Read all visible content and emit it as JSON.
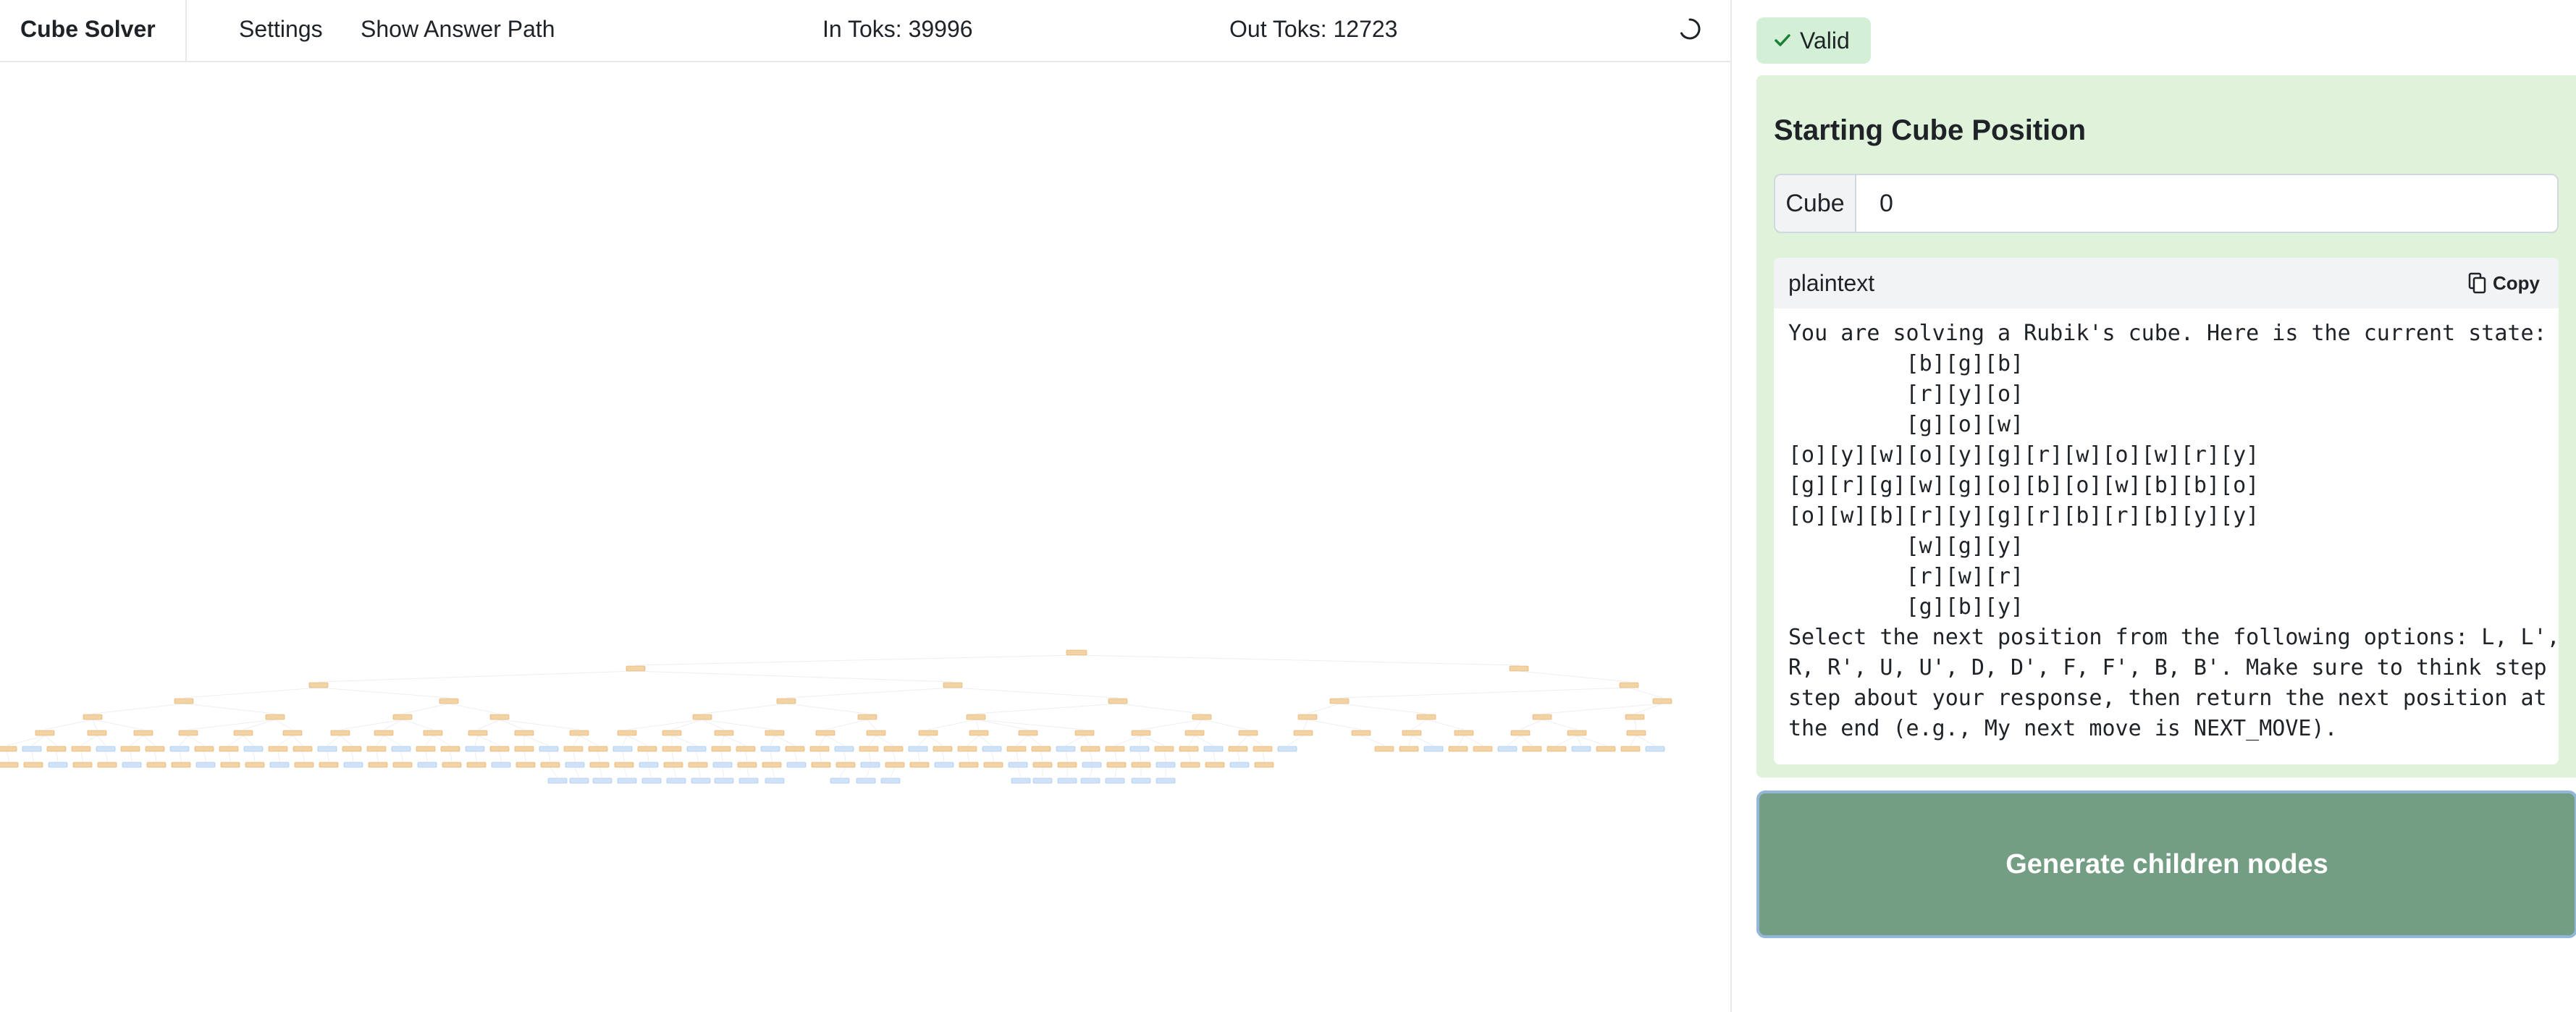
{
  "app": {
    "brand": "Cube Solver",
    "nav": {
      "settings": "Settings",
      "show_answer_path": "Show Answer Path"
    },
    "in_toks": "In Toks: 39996",
    "out_toks": "Out Toks: 12723",
    "loading_icon": "spinner-icon"
  },
  "panel": {
    "status_badge": {
      "label": "Valid",
      "icon": "check-icon",
      "color": "#1a7f37"
    },
    "card": {
      "title": "Starting Cube Position",
      "cube_field": {
        "label": "Cube",
        "value": "0"
      },
      "code_block": {
        "language": "plaintext",
        "copy_label": "Copy",
        "content": "You are solving a Rubik's cube. Here is the current state:\n         [b][g][b]\n         [r][y][o]\n         [g][o][w]\n[o][y][w][o][y][g][r][w][o][w][r][y]\n[g][r][g][w][g][o][b][o][w][b][b][o]\n[o][w][b][r][y][g][r][b][r][b][y][y]\n         [w][g][y]\n         [r][w][r]\n         [g][b][y]\nSelect the next position from the following options: L, L',\nR, R', U, U', D, D', F, F', B, B'. Make sure to think step by\nstep about your response, then return the next position at\nthe end (e.g., My next move is NEXT_MOVE)."
      },
      "background": "#dff2da"
    },
    "generate_button": {
      "label": "Generate children nodes",
      "color": "#739e83"
    }
  },
  "tree": {
    "node_colors": {
      "default": "#f3d3a4",
      "leaf": "#cfe2f7"
    }
  }
}
